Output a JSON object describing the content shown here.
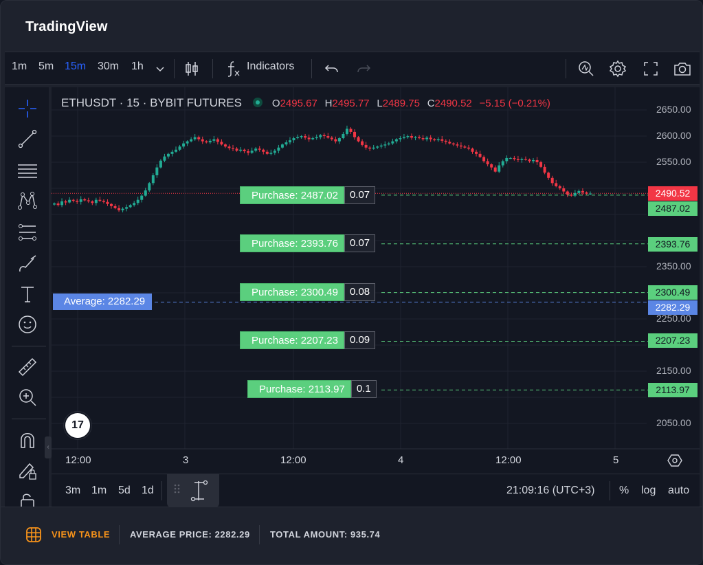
{
  "app": {
    "title": "TradingView"
  },
  "toolbar": {
    "intervals": [
      "1m",
      "5m",
      "15m",
      "30m",
      "1h"
    ],
    "active_interval": "15m",
    "indicators_label": "Indicators"
  },
  "symbol": {
    "name": "ETHUSDT · 15 · BYBIT FUTURES",
    "o_label": "O",
    "o": "2495.67",
    "h_label": "H",
    "h": "2495.77",
    "l_label": "L",
    "l": "2489.75",
    "c_label": "C",
    "c": "2490.52",
    "change": "−5.15 (−0.21%)"
  },
  "orders": [
    {
      "label": "Purchase: 2487.02",
      "qty": "0.07",
      "price": "2487.02"
    },
    {
      "label": "Purchase: 2393.76",
      "qty": "0.07",
      "price": "2393.76"
    },
    {
      "label": "Purchase: 2300.49",
      "qty": "0.08",
      "price": "2300.49"
    },
    {
      "label": "Purchase: 2207.23",
      "qty": "0.09",
      "price": "2207.23"
    },
    {
      "label": "Purchase: 2113.97",
      "qty": "0.1",
      "price": "2113.97"
    }
  ],
  "average": {
    "label": "Average: 2282.29",
    "price": "2282.29"
  },
  "last_price": "2490.52",
  "y_axis": [
    "2650.00",
    "2600.00",
    "2550.00",
    "2350.00",
    "2250.00",
    "2150.00",
    "2050.00"
  ],
  "x_axis": [
    "12:00",
    "3",
    "12:00",
    "4",
    "12:00",
    "5"
  ],
  "bottom": {
    "ranges": [
      "3m",
      "1m",
      "5d",
      "1d"
    ],
    "clock": "21:09:16 (UTC+3)",
    "percent": "%",
    "log": "log",
    "auto": "auto"
  },
  "footer": {
    "view_table": "VIEW TABLE",
    "average_price": "AVERAGE PRICE:  2282.29",
    "total_amount": "TOTAL AMOUNT:  935.74"
  },
  "colors": {
    "up": "#22ab94",
    "down": "#f23645",
    "accent": "#2962ff",
    "order": "#5bcf7e",
    "average": "#5b86e5",
    "footer_accent": "#f7931a"
  },
  "chart_data": {
    "type": "candlestick",
    "title": "ETHUSDT · 15 · BYBIT FUTURES",
    "ylim": [
      2000,
      2680
    ],
    "series": [
      {
        "name": "ETHUSDT",
        "values": [
          2471,
          2468,
          2475,
          2473,
          2478,
          2476,
          2474,
          2479,
          2477,
          2475,
          2472,
          2478,
          2476,
          2474,
          2470,
          2466,
          2462,
          2458,
          2461,
          2464,
          2468,
          2472,
          2478,
          2486,
          2496,
          2510,
          2525,
          2540,
          2553,
          2561,
          2566,
          2570,
          2574,
          2580,
          2586,
          2590,
          2594,
          2598,
          2594,
          2590,
          2588,
          2591,
          2594,
          2589,
          2584,
          2580,
          2577,
          2576,
          2572,
          2574,
          2571,
          2568,
          2572,
          2576,
          2574,
          2570,
          2566,
          2568,
          2572,
          2578,
          2584,
          2588,
          2592,
          2596,
          2598,
          2600,
          2597,
          2594,
          2596,
          2598,
          2602,
          2600,
          2597,
          2594,
          2590,
          2596,
          2604,
          2614,
          2608,
          2598,
          2590,
          2583,
          2578,
          2576,
          2578,
          2580,
          2582,
          2584,
          2586,
          2590,
          2594,
          2596,
          2598,
          2600,
          2597,
          2598,
          2596,
          2594,
          2597,
          2594,
          2592,
          2594,
          2591,
          2589,
          2586,
          2584,
          2582,
          2580,
          2578,
          2576,
          2570,
          2566,
          2560,
          2552,
          2546,
          2540,
          2532,
          2544,
          2552,
          2558,
          2558,
          2556,
          2554,
          2556,
          2555,
          2552,
          2554,
          2550,
          2541,
          2530,
          2520,
          2510,
          2504,
          2500,
          2494,
          2488,
          2486,
          2491,
          2495,
          2492,
          2490,
          2490
        ]
      }
    ],
    "orders": [
      2487.02,
      2393.76,
      2300.49,
      2207.23,
      2113.97
    ],
    "order_qty": [
      0.07,
      0.07,
      0.08,
      0.09,
      0.1
    ],
    "average": 2282.29,
    "last": 2490.52
  }
}
